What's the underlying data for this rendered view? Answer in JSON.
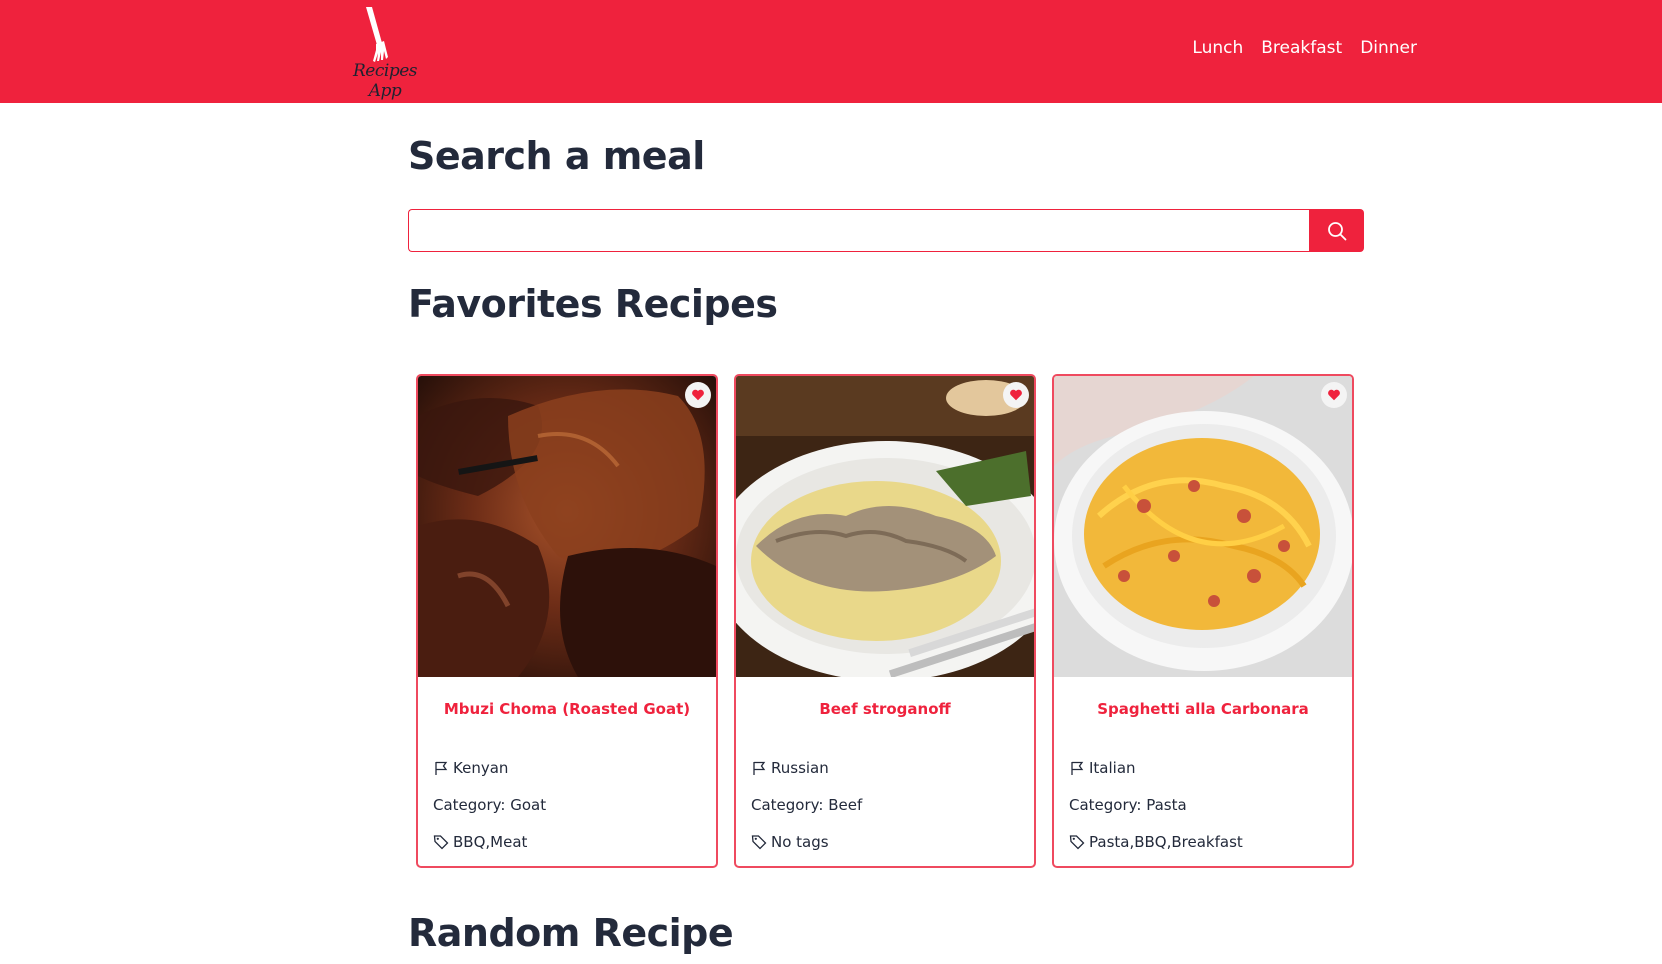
{
  "header": {
    "logo_text": "Recipes App",
    "nav": [
      "Lunch",
      "Breakfast",
      "Dinner"
    ]
  },
  "search": {
    "title": "Search a meal",
    "value": "",
    "placeholder": ""
  },
  "favorites": {
    "title": "Favorites Recipes",
    "cards": [
      {
        "title": "Mbuzi Choma (Roasted Goat)",
        "area": "Kenyan",
        "category": "Category: Goat",
        "tags": "BBQ,Meat"
      },
      {
        "title": "Beef stroganoff",
        "area": "Russian",
        "category": "Category: Beef",
        "tags": "No tags"
      },
      {
        "title": "Spaghetti alla Carbonara",
        "area": "Italian",
        "category": "Category: Pasta",
        "tags": "Pasta,BBQ,Breakfast"
      }
    ]
  },
  "random": {
    "title": "Random Recipe"
  },
  "colors": {
    "brand": "#ef223d",
    "text": "#232a3b"
  }
}
